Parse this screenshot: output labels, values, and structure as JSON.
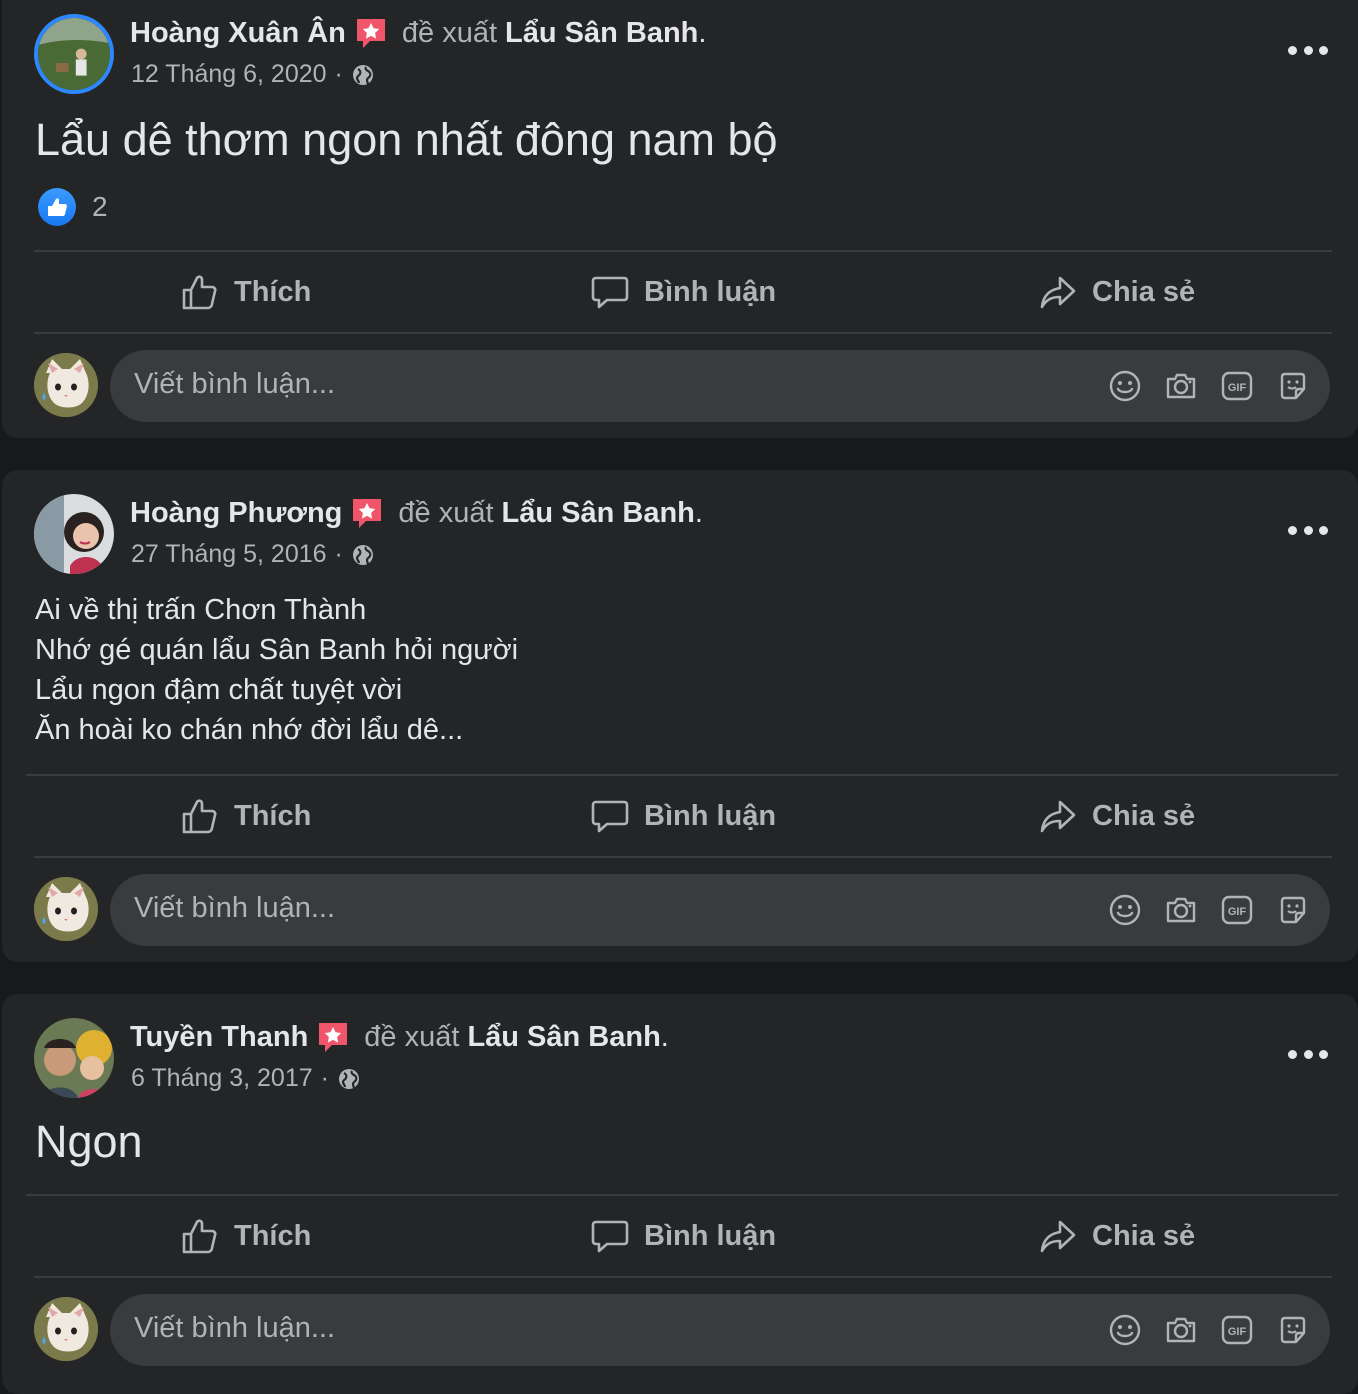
{
  "common": {
    "recommend_text": "đề xuất",
    "page_name": "Lẩu Sân Banh",
    "dot": ".",
    "meta_sep": "·",
    "actions": {
      "like": "Thích",
      "comment": "Bình luận",
      "share": "Chia sẻ"
    },
    "comment_placeholder": "Viết bình luận...",
    "gif_label": "GIF"
  },
  "posts": [
    {
      "author": "Hoàng Xuân Ân",
      "date": "12 Tháng 6, 2020",
      "text": "Lẩu dê thơm ngon nhất đông nam bộ",
      "reaction_count": "2"
    },
    {
      "author": "Hoàng Phương",
      "date": "27 Tháng 5, 2016",
      "text": "Ai về thị trấn Chơn Thành\nNhớ gé quán lẩu Sân Banh hỏi người\nLẩu ngon đậm chất tuyệt vời\nĂn hoài ko chán nhớ đời lẩu dê..."
    },
    {
      "author": "Tuyền Thanh",
      "date": "6 Tháng 3, 2017",
      "text": "Ngon"
    }
  ],
  "colors": {
    "page_bg": "#18191a",
    "card_bg": "#242526",
    "input_bg": "#3a3b3c",
    "primary_text": "#e4e6eb",
    "secondary_text": "#b0b3b8",
    "like_blue": "#1877f2",
    "badge_red": "#f02849"
  }
}
